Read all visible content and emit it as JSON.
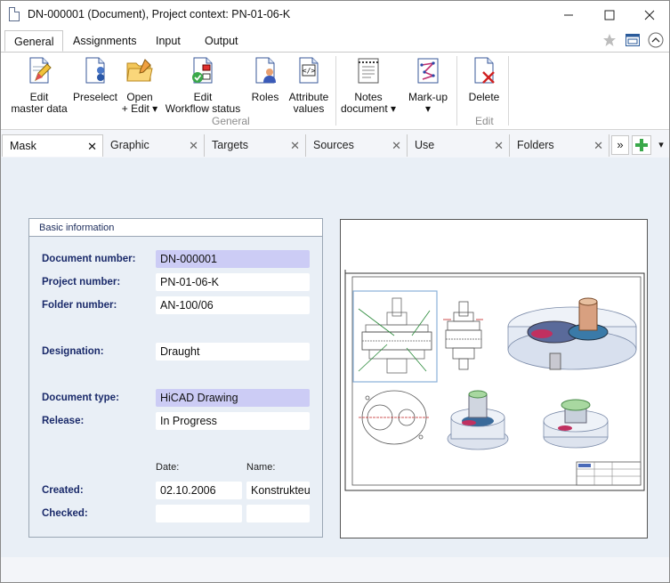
{
  "window": {
    "title": "DN-000001 (Document), Project context: PN-01-06-K",
    "icons": {
      "doc": "document-icon",
      "minimize": "minimize-icon",
      "maximize": "maximize-icon",
      "close": "close-icon"
    }
  },
  "ribbon_tabs": [
    "General",
    "Assignments",
    "Input",
    "Output"
  ],
  "ribbon_right_icons": [
    "star-icon",
    "window-layout-icon",
    "collapse-ribbon-icon"
  ],
  "ribbon": {
    "buttons": [
      {
        "line1": "Edit",
        "line2": "master data",
        "icon": "edit-document-icon"
      },
      {
        "line1": "Preselect",
        "line2": "",
        "icon": "preselect-icon"
      },
      {
        "line1": "Open",
        "line2": "+ Edit ▾",
        "icon": "folder-open-icon"
      },
      {
        "line1": "Edit",
        "line2": "Workflow status",
        "icon": "workflow-status-icon"
      },
      {
        "line1": "Roles",
        "line2": "",
        "icon": "roles-icon"
      },
      {
        "line1": "Attribute",
        "line2": "values",
        "icon": "attribute-values-icon"
      },
      {
        "line1": "Notes",
        "line2": "document ▾",
        "icon": "notes-icon"
      },
      {
        "line1": "Mark-up",
        "line2": "▾",
        "icon": "markup-icon"
      },
      {
        "line1": "Delete",
        "line2": "",
        "icon": "delete-icon"
      }
    ],
    "groups": [
      "General",
      "Edit"
    ]
  },
  "doc_tabs": [
    "Mask",
    "Graphic",
    "Targets",
    "Sources",
    "Use",
    "Folders"
  ],
  "doc_tab_controls": {
    "overflow": "»",
    "add_icon": "add-tab-icon",
    "menu": "▾"
  },
  "basic_info": {
    "header": "Basic information",
    "fields": [
      {
        "label": "Document number:",
        "value": "DN-000001",
        "required": true
      },
      {
        "label": "Project number:",
        "value": "PN-01-06-K",
        "required": false
      },
      {
        "label": "Folder number:",
        "value": "AN-100/06",
        "required": false
      },
      {
        "label": "Designation:",
        "value": "Draught",
        "required": false
      },
      {
        "label": "Document type:",
        "value": "HiCAD Drawing",
        "required": true
      },
      {
        "label": "Release:",
        "value": "In Progress",
        "required": false
      }
    ],
    "date_header": "Date:",
    "name_header": "Name:",
    "created": {
      "label": "Created:",
      "date": "02.10.2006",
      "name": "Konstrukteur"
    },
    "checked": {
      "label": "Checked:",
      "date": "",
      "name": ""
    }
  },
  "colors": {
    "required_field": "#ccccf5",
    "label": "#1a2a6a",
    "accent": "#1f5fa8"
  }
}
